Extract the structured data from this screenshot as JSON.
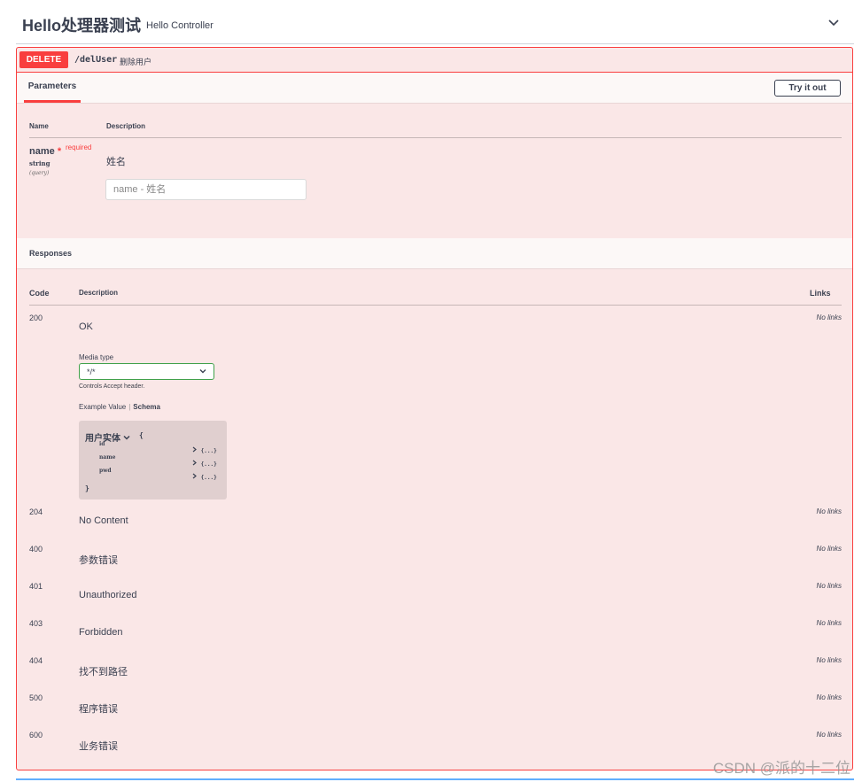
{
  "tag": {
    "title": "Hello处理器测试",
    "description": "Hello Controller",
    "chevron_icon": "chevron-down-icon"
  },
  "operation": {
    "method": "DELETE",
    "path": "/delUser",
    "summary": "删除用户",
    "method_color": "#f93e3e"
  },
  "parameters": {
    "tab_label": "Parameters",
    "try_label": "Try it out",
    "col_name": "Name",
    "col_desc": "Description",
    "param": {
      "name": "name",
      "star": "*",
      "required": "required",
      "type": "string",
      "in": "(query)",
      "description": "姓名",
      "placeholder": "name - 姓名"
    }
  },
  "responses": {
    "title": "Responses",
    "col_code": "Code",
    "col_desc": "Description",
    "col_links": "Links",
    "media_type_label": "Media type",
    "media_type_value": "*/*",
    "controls_text": "Controls Accept header.",
    "example_tab": "Example Value",
    "schema_tab": "Schema",
    "model": {
      "title": "用户实体",
      "open": "{",
      "close": "}",
      "props": [
        {
          "name": "id",
          "value": "{...}"
        },
        {
          "name": "name",
          "value": "{...}"
        },
        {
          "name": "pwd",
          "value": "{...}"
        }
      ]
    },
    "rows": [
      {
        "code": "200",
        "desc": "OK",
        "links": "No links"
      },
      {
        "code": "204",
        "desc": "No Content",
        "links": "No links"
      },
      {
        "code": "400",
        "desc": "参数错误",
        "links": "No links"
      },
      {
        "code": "401",
        "desc": "Unauthorized",
        "links": "No links"
      },
      {
        "code": "403",
        "desc": "Forbidden",
        "links": "No links"
      },
      {
        "code": "404",
        "desc": "找不到路径",
        "links": "No links"
      },
      {
        "code": "500",
        "desc": "程序错误",
        "links": "No links"
      },
      {
        "code": "600",
        "desc": "业务错误",
        "links": "No links"
      }
    ]
  },
  "watermark": "CSDN @派的十二位"
}
